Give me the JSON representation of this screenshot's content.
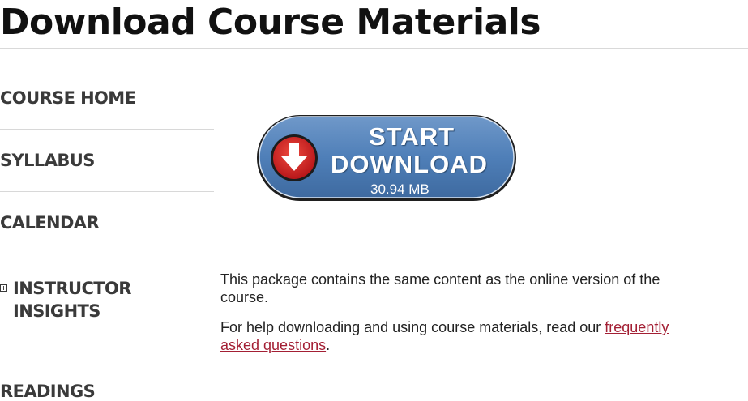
{
  "page": {
    "title": "Download Course Materials"
  },
  "sidebar": {
    "items": [
      {
        "label": "COURSE HOME"
      },
      {
        "label": "SYLLABUS"
      },
      {
        "label": "CALENDAR"
      },
      {
        "label": "INSTRUCTOR INSIGHTS",
        "expand_icon": "plus-box-icon",
        "expand_glyph": "+"
      },
      {
        "label": "READINGS"
      }
    ]
  },
  "download": {
    "line1": "START",
    "line2": "DOWNLOAD",
    "size": "30.94 MB",
    "icon": "download-arrow-icon",
    "colors": {
      "button": "#4f7fb8",
      "arrow_circle": "#d9231f"
    }
  },
  "content": {
    "description": "This package contains the same content as the online version of the course.",
    "help_prefix": "For help downloading and using course materials, read our ",
    "help_link": "frequently asked questions",
    "help_suffix": ".",
    "link_color": "#a31f34"
  }
}
